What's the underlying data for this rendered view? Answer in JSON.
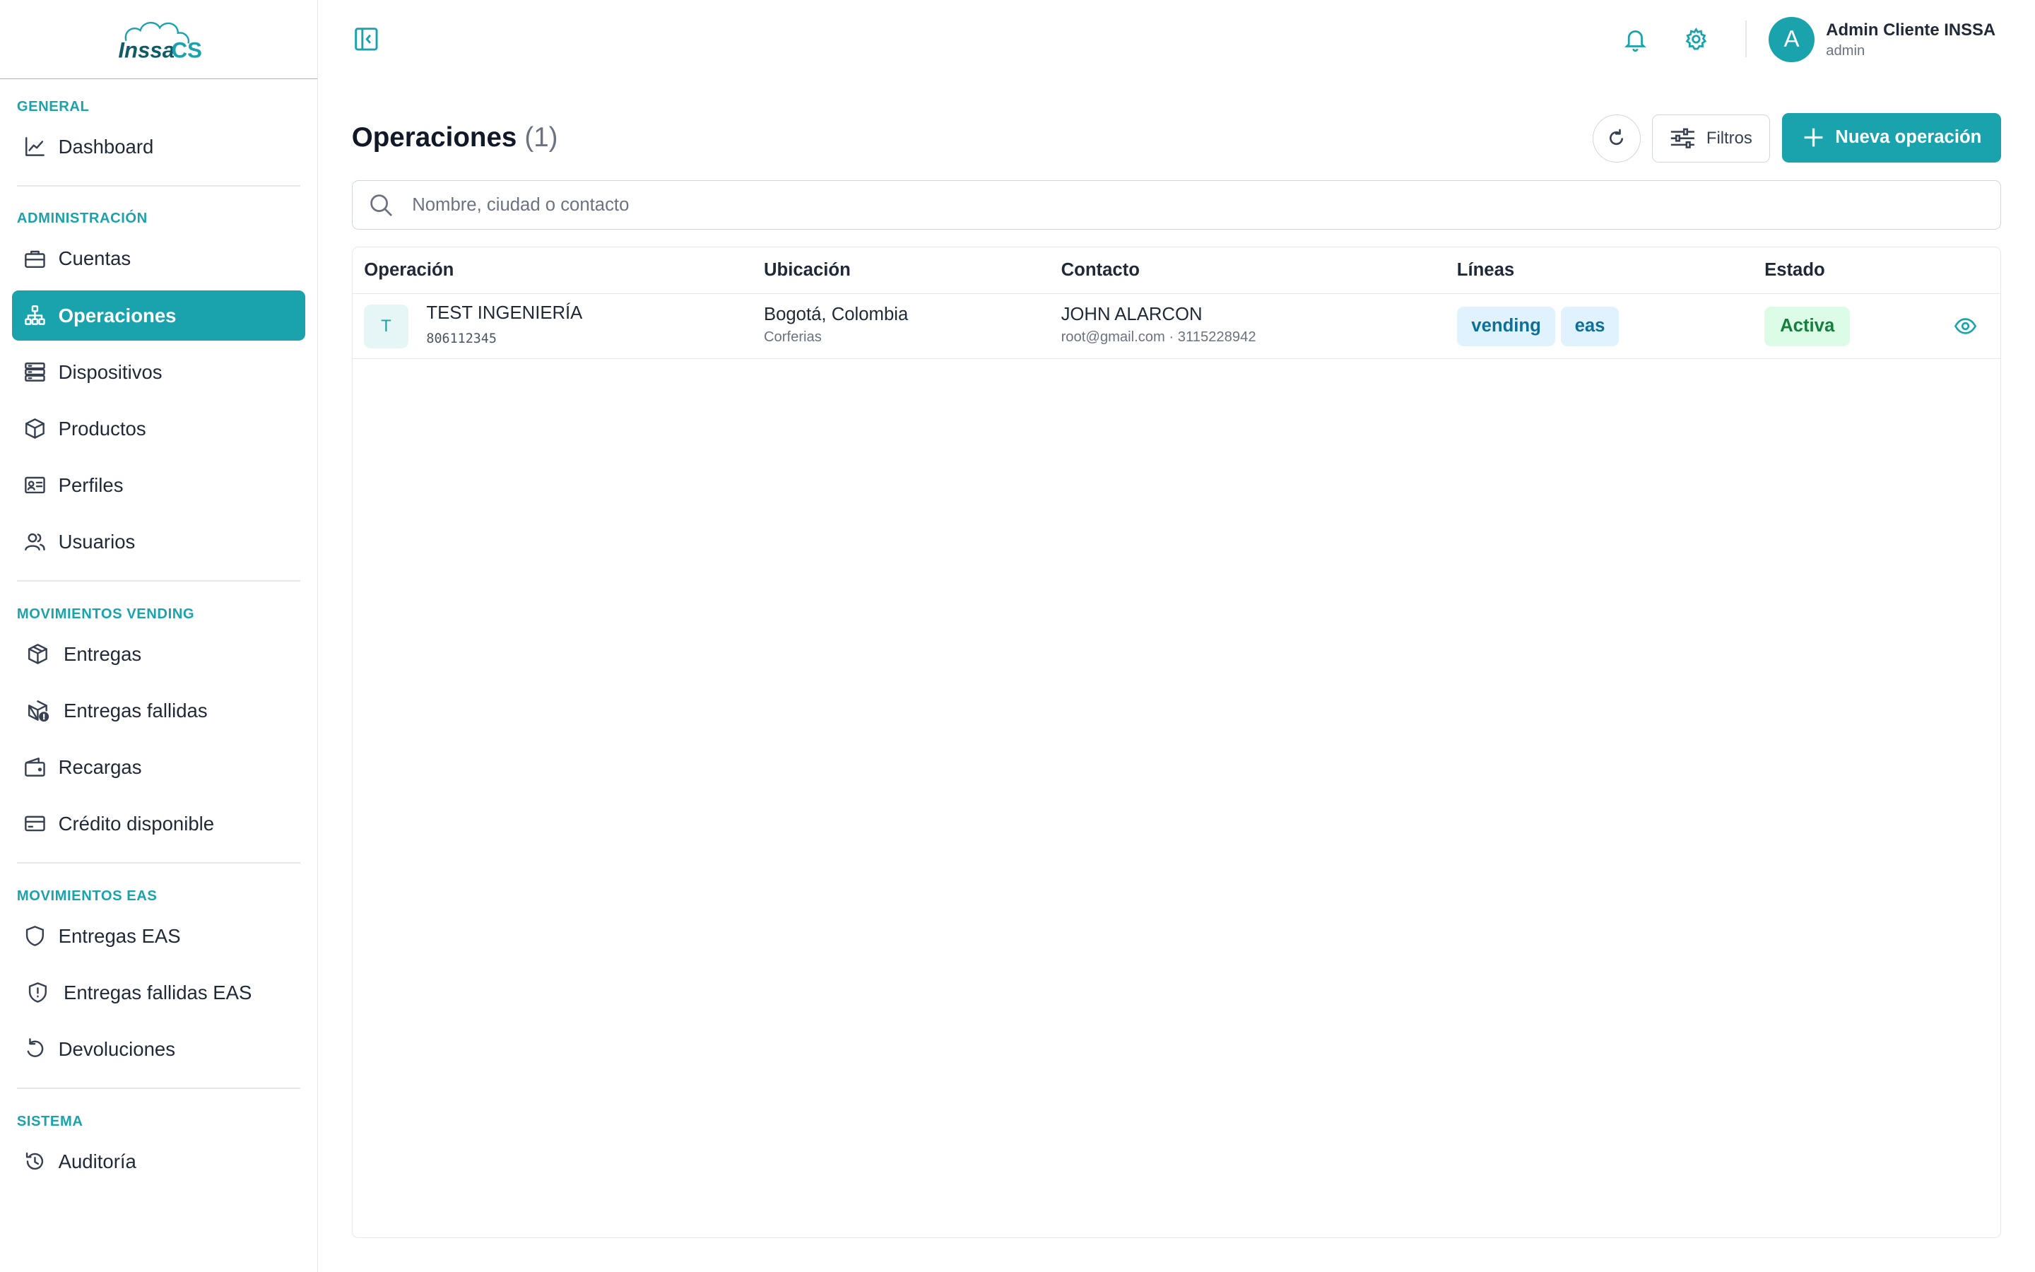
{
  "brand": {
    "logo_text": "INSSA CS",
    "accent": "#1aa3ad"
  },
  "sidebar": {
    "sections": [
      {
        "title": "GENERAL",
        "items": [
          {
            "label": "Dashboard",
            "icon": "chart-line-icon"
          }
        ]
      },
      {
        "title": "ADMINISTRACIÓN",
        "items": [
          {
            "label": "Cuentas",
            "icon": "briefcase-icon"
          },
          {
            "label": "Operaciones",
            "icon": "sitemap-icon",
            "active": true
          },
          {
            "label": "Dispositivos",
            "icon": "server-icon"
          },
          {
            "label": "Productos",
            "icon": "box-icon"
          },
          {
            "label": "Perfiles",
            "icon": "id-card-icon"
          },
          {
            "label": "Usuarios",
            "icon": "users-icon"
          }
        ]
      },
      {
        "title": "MOVIMIENTOS VENDING",
        "items": [
          {
            "label": "Entregas",
            "icon": "package-icon"
          },
          {
            "label": "Entregas fallidas",
            "icon": "package-alert-icon"
          },
          {
            "label": "Recargas",
            "icon": "wallet-icon"
          },
          {
            "label": "Crédito disponible",
            "icon": "credit-card-icon"
          }
        ]
      },
      {
        "title": "MOVIMIENTOS EAS",
        "items": [
          {
            "label": "Entregas EAS",
            "icon": "shield-icon"
          },
          {
            "label": "Entregas fallidas EAS",
            "icon": "shield-alert-icon"
          },
          {
            "label": "Devoluciones",
            "icon": "undo-icon"
          }
        ]
      },
      {
        "title": "SISTEMA",
        "items": [
          {
            "label": "Auditoría",
            "icon": "history-icon"
          }
        ]
      }
    ]
  },
  "topbar": {
    "user_initial": "A",
    "user_name": "Admin Cliente INSSA",
    "user_role": "admin"
  },
  "main": {
    "title": "Operaciones",
    "count": "(1)",
    "filters_label": "Filtros",
    "new_label": "Nueva operación",
    "search_placeholder": "Nombre, ciudad o contacto"
  },
  "table": {
    "headers": [
      "Operación",
      "Ubicación",
      "Contacto",
      "Líneas",
      "Estado"
    ],
    "rows": [
      {
        "initial": "T",
        "name": "TEST INGENIERÍA",
        "code": "806112345",
        "city": "Bogotá, Colombia",
        "place": "Corferias",
        "contact_name": "JOHN ALARCON",
        "contact_detail": "root@gmail.com · 3115228942",
        "lines": [
          "vending",
          "eas"
        ],
        "status": "Activa"
      }
    ]
  }
}
